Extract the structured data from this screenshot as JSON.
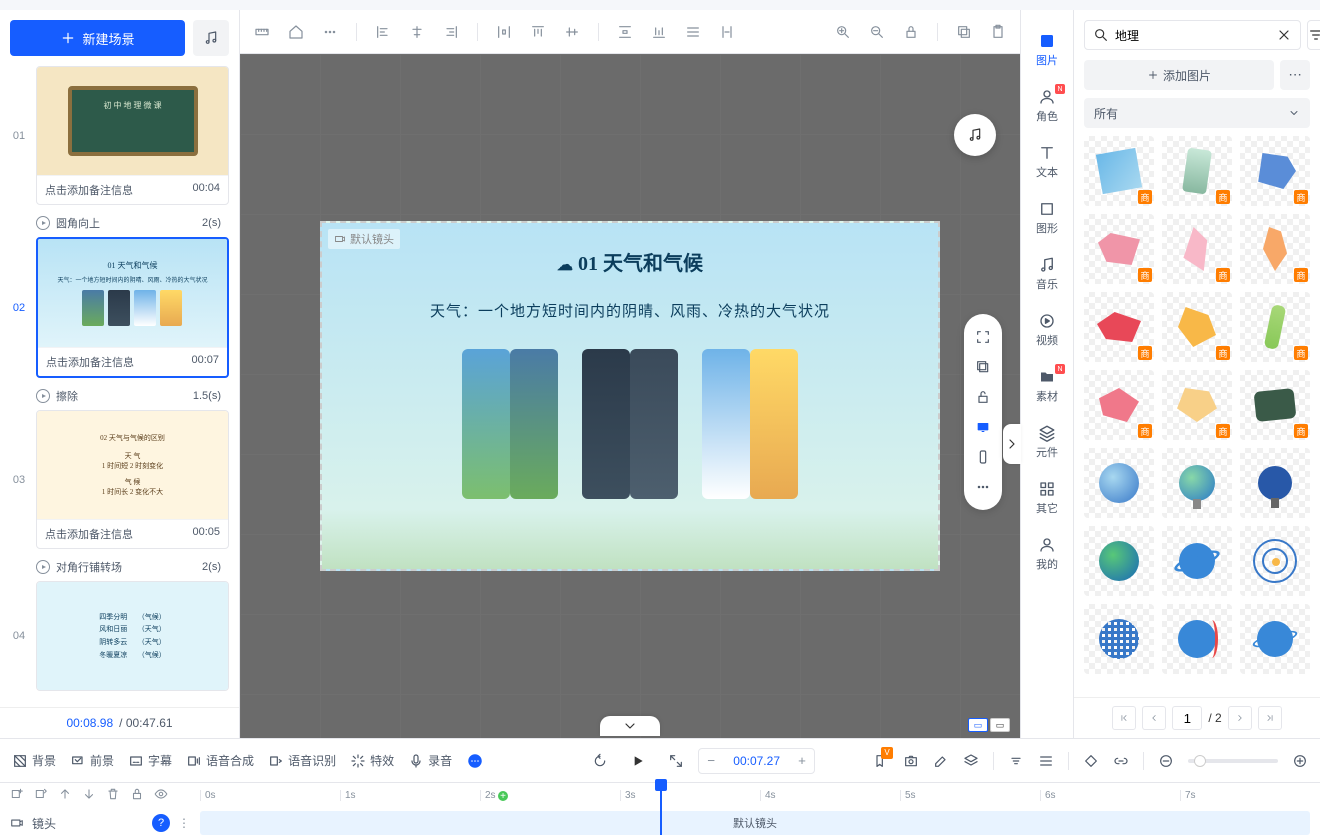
{
  "sidebar": {
    "new_scene_label": "新建场景",
    "scenes": [
      {
        "num": "01",
        "note": "点击添加备注信息",
        "time": "00:04",
        "trans": "圆角向上",
        "trans_dur": "2(s)"
      },
      {
        "num": "02",
        "note": "点击添加备注信息",
        "time": "00:07",
        "trans": "擦除",
        "trans_dur": "1.5(s)"
      },
      {
        "num": "03",
        "note": "点击添加备注信息",
        "time": "00:05",
        "trans": "对角行铺转场",
        "trans_dur": "2(s)"
      },
      {
        "num": "04",
        "note": "",
        "time": ""
      }
    ],
    "current_time": "00:08.98",
    "total_time": "/ 00:47.61"
  },
  "canvas": {
    "camera_label": "默认镜头",
    "slide_title": "01 天气和气候",
    "slide_subtitle": "天气：一个地方短时间内的阴晴、风雨、冷热的大气状况"
  },
  "vnav": {
    "items": [
      {
        "label": "图片",
        "active": true,
        "badge": false
      },
      {
        "label": "角色",
        "badge": true
      },
      {
        "label": "文本"
      },
      {
        "label": "图形"
      },
      {
        "label": "音乐"
      },
      {
        "label": "视频"
      },
      {
        "label": "素材",
        "badge": true
      },
      {
        "label": "元件"
      },
      {
        "label": "其它"
      },
      {
        "label": "我的"
      }
    ]
  },
  "rpanel": {
    "search_value": "地理",
    "add_image_label": "添加图片",
    "filter_label": "所有",
    "page": "1",
    "total_pages": "/ 2"
  },
  "bottom": {
    "items": [
      "背景",
      "前景",
      "字幕",
      "语音合成",
      "语音识别",
      "特效",
      "录音"
    ],
    "time": "00:07.27"
  },
  "timeline": {
    "camera_label": "镜头",
    "track_label": "默认镜头",
    "ticks": [
      "0s",
      "1s",
      "2s",
      "3s",
      "4s",
      "5s",
      "6s",
      "7s"
    ]
  }
}
